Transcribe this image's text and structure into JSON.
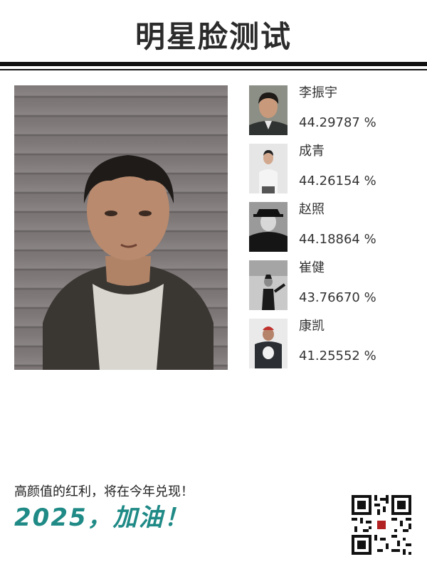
{
  "header": {
    "title": "明星脸测试"
  },
  "main_photo": {
    "icon": "photo-of-person"
  },
  "matches": [
    {
      "name": "李振宇",
      "score": "44.29787 %",
      "icon": "celebrity-photo"
    },
    {
      "name": "成青",
      "score": "44.26154 %",
      "icon": "celebrity-photo"
    },
    {
      "name": "赵照",
      "score": "44.18864 %",
      "icon": "celebrity-photo"
    },
    {
      "name": "崔健",
      "score": "43.76670 %",
      "icon": "celebrity-photo"
    },
    {
      "name": "康凯",
      "score": "41.25552 %",
      "icon": "celebrity-photo"
    }
  ],
  "footer": {
    "line": "高颜值的红利，将在今年兑现！",
    "slogan": "2025，加油！",
    "qr_icon": "qr-code"
  },
  "colors": {
    "title": "#2b2b2b",
    "rule": "#111111",
    "slogan": "#1f8a86",
    "text": "#333333"
  }
}
